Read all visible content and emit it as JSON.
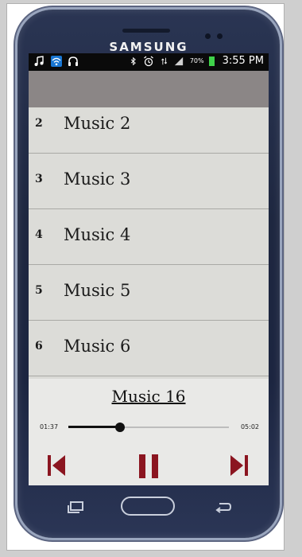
{
  "device": {
    "brand": "SAMSUNG"
  },
  "statusbar": {
    "time": "3:55 PM",
    "battery": "70%",
    "left_icons": [
      "music-note-icon",
      "wifi-icon",
      "headphones-icon"
    ],
    "right_icons": [
      "bluetooth-icon",
      "alarm-icon",
      "network-icon",
      "signal-icon",
      "battery-icon"
    ]
  },
  "playlist": {
    "items": [
      {
        "number": "2",
        "title": "Music 2"
      },
      {
        "number": "3",
        "title": "Music 3"
      },
      {
        "number": "4",
        "title": "Music 4"
      },
      {
        "number": "5",
        "title": "Music 5"
      },
      {
        "number": "6",
        "title": "Music 6"
      }
    ]
  },
  "player": {
    "now_playing": "Music 16",
    "current_time": "01:37",
    "total_time": "05:02",
    "progress": 0.32
  },
  "colors": {
    "accent": "#8b1520",
    "appbar": "#8b8686",
    "list_bg": "#dcdcd8",
    "player_bg": "#e9e9e7"
  },
  "controls": [
    "previous-icon",
    "pause-icon",
    "next-icon"
  ],
  "navbar": [
    "recent-apps-icon",
    "home-button",
    "back-icon"
  ]
}
